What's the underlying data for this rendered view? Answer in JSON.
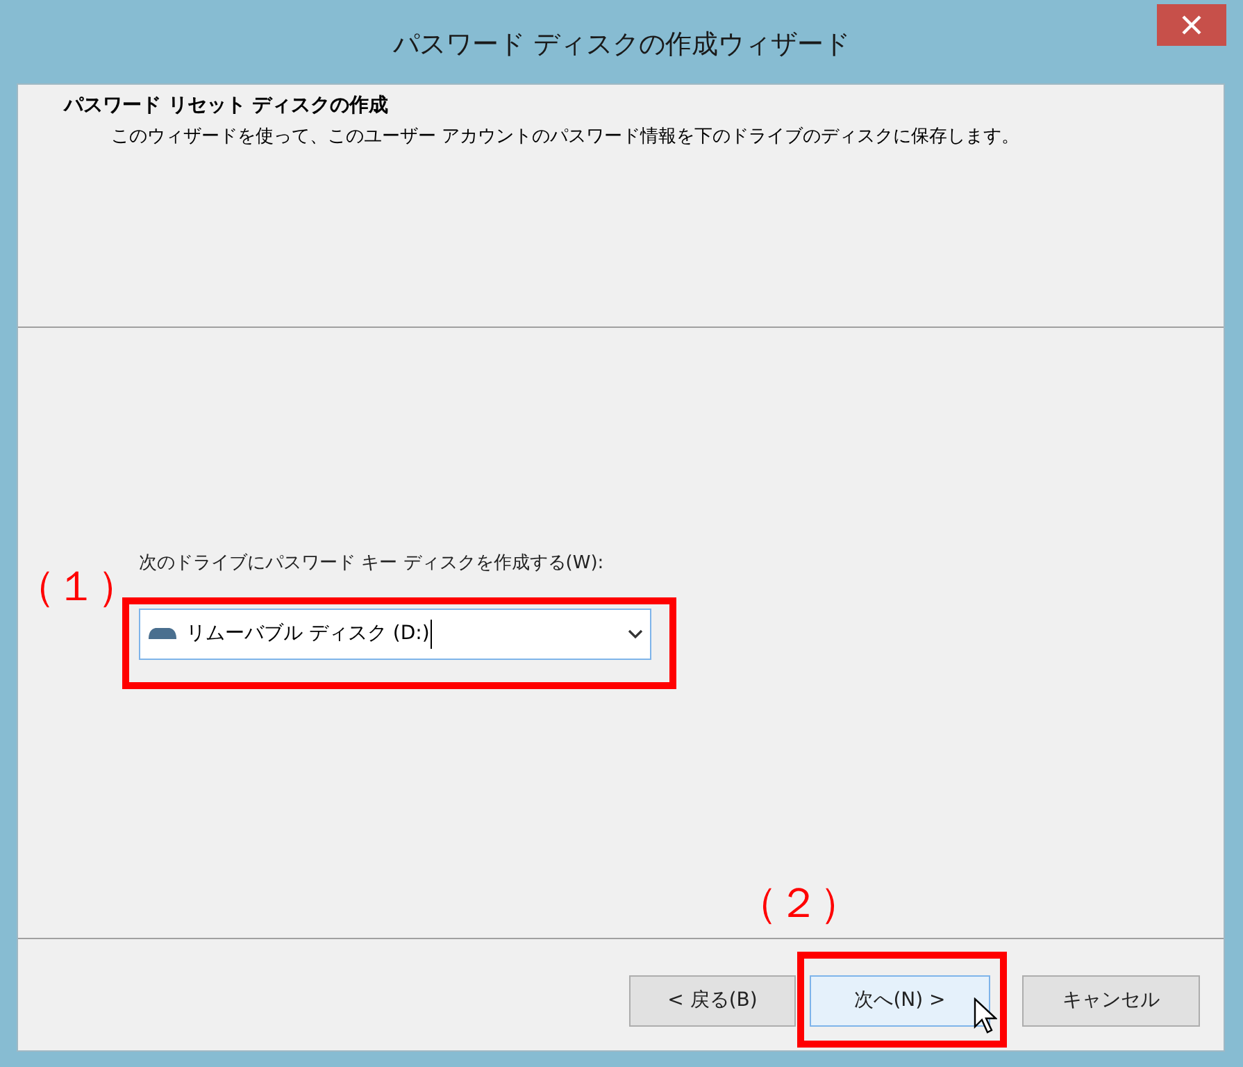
{
  "window": {
    "title": "パスワード ディスクの作成ウィザード"
  },
  "header": {
    "title": "パスワード リセット ディスクの作成",
    "description": "このウィザードを使って、このユーザー アカウントのパスワード情報を下のドライブのディスクに保存します。"
  },
  "drive": {
    "label": "次のドライブにパスワード キー ディスクを作成する(W):",
    "value": "リムーバブル ディスク (D:)"
  },
  "buttons": [
    {
      "label": "< 戻る(B)",
      "highlighted": false
    },
    {
      "label": "次へ(N) >",
      "highlighted": true
    },
    {
      "label": "キャンセル",
      "highlighted": false
    }
  ],
  "annotations": [
    {
      "label": "（１）"
    },
    {
      "label": "（２）"
    }
  ]
}
